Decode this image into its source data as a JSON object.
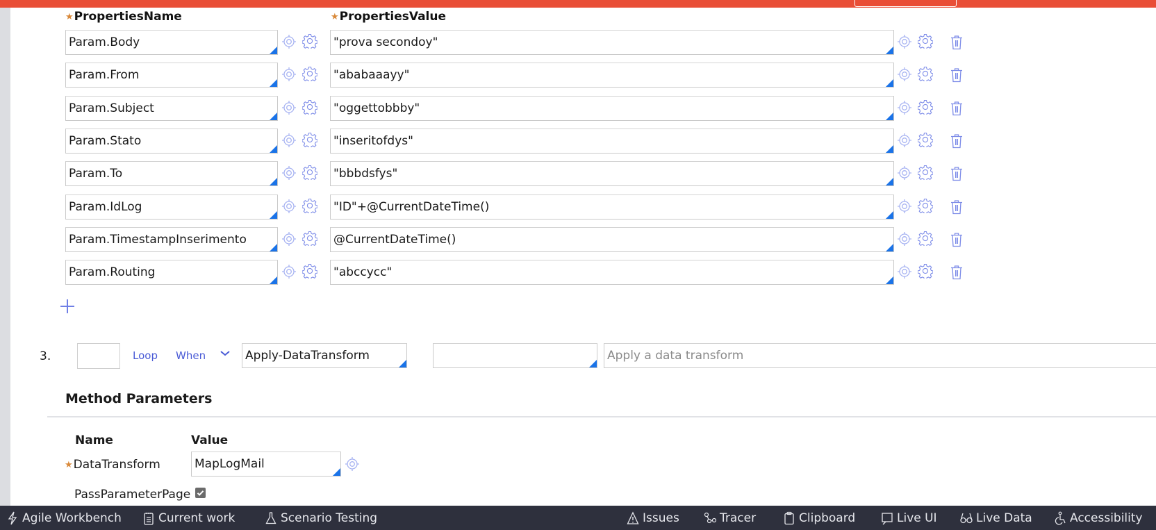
{
  "colors": {
    "accent_bar": "#e94e36",
    "link": "#4a5bd6",
    "icon": "#7d8ce8",
    "corner": "#1a73e8",
    "required": "#d9893a",
    "footer_bg": "#2e303d"
  },
  "properties_table": {
    "name_header": "PropertiesName",
    "value_header": "PropertiesValue",
    "rows": [
      {
        "name": "Param.Body",
        "value": "\"prova secondoy\""
      },
      {
        "name": "Param.From",
        "value": "\"ababaaayy\""
      },
      {
        "name": "Param.Subject",
        "value": "\"oggettobbby\""
      },
      {
        "name": "Param.Stato",
        "value": "\"inseritofdys\""
      },
      {
        "name": "Param.To",
        "value": "\"bbbdsfys\""
      },
      {
        "name": "Param.IdLog",
        "value": "\"ID\"+@CurrentDateTime()"
      },
      {
        "name": "Param.TimestampInserimento",
        "value": "@CurrentDateTime()"
      },
      {
        "name": "Param.Routing",
        "value": "\"abccycc\""
      }
    ],
    "row_icons": [
      "crosshair-icon",
      "gear-icon",
      "trash-icon"
    ],
    "add_icon": "plus-icon"
  },
  "step": {
    "number": "3.",
    "label_value": "",
    "loop_label": "Loop",
    "when_label": "When",
    "method": "Apply-DataTransform",
    "step_page": "",
    "description_placeholder": "Apply a data transform"
  },
  "method_parameters": {
    "title": "Method Parameters",
    "name_header": "Name",
    "value_header": "Value",
    "params": [
      {
        "name": "DataTransform",
        "value": "MapLogMail",
        "required": true
      },
      {
        "name": "PassParameterPage",
        "checked": true
      }
    ]
  },
  "footer": {
    "left": [
      {
        "icon": "lightning-icon",
        "label": "Agile Workbench"
      },
      {
        "icon": "clipboard-list-icon",
        "label": "Current work"
      },
      {
        "icon": "flask-icon",
        "label": "Scenario Testing"
      }
    ],
    "right": [
      {
        "icon": "warning-icon",
        "label": "Issues"
      },
      {
        "icon": "tracer-icon",
        "label": "Tracer"
      },
      {
        "icon": "clipboard-icon",
        "label": "Clipboard"
      },
      {
        "icon": "live-ui-icon",
        "label": "Live UI"
      },
      {
        "icon": "glasses-icon",
        "label": "Live Data"
      },
      {
        "icon": "accessibility-icon",
        "label": "Accessibility"
      }
    ]
  }
}
